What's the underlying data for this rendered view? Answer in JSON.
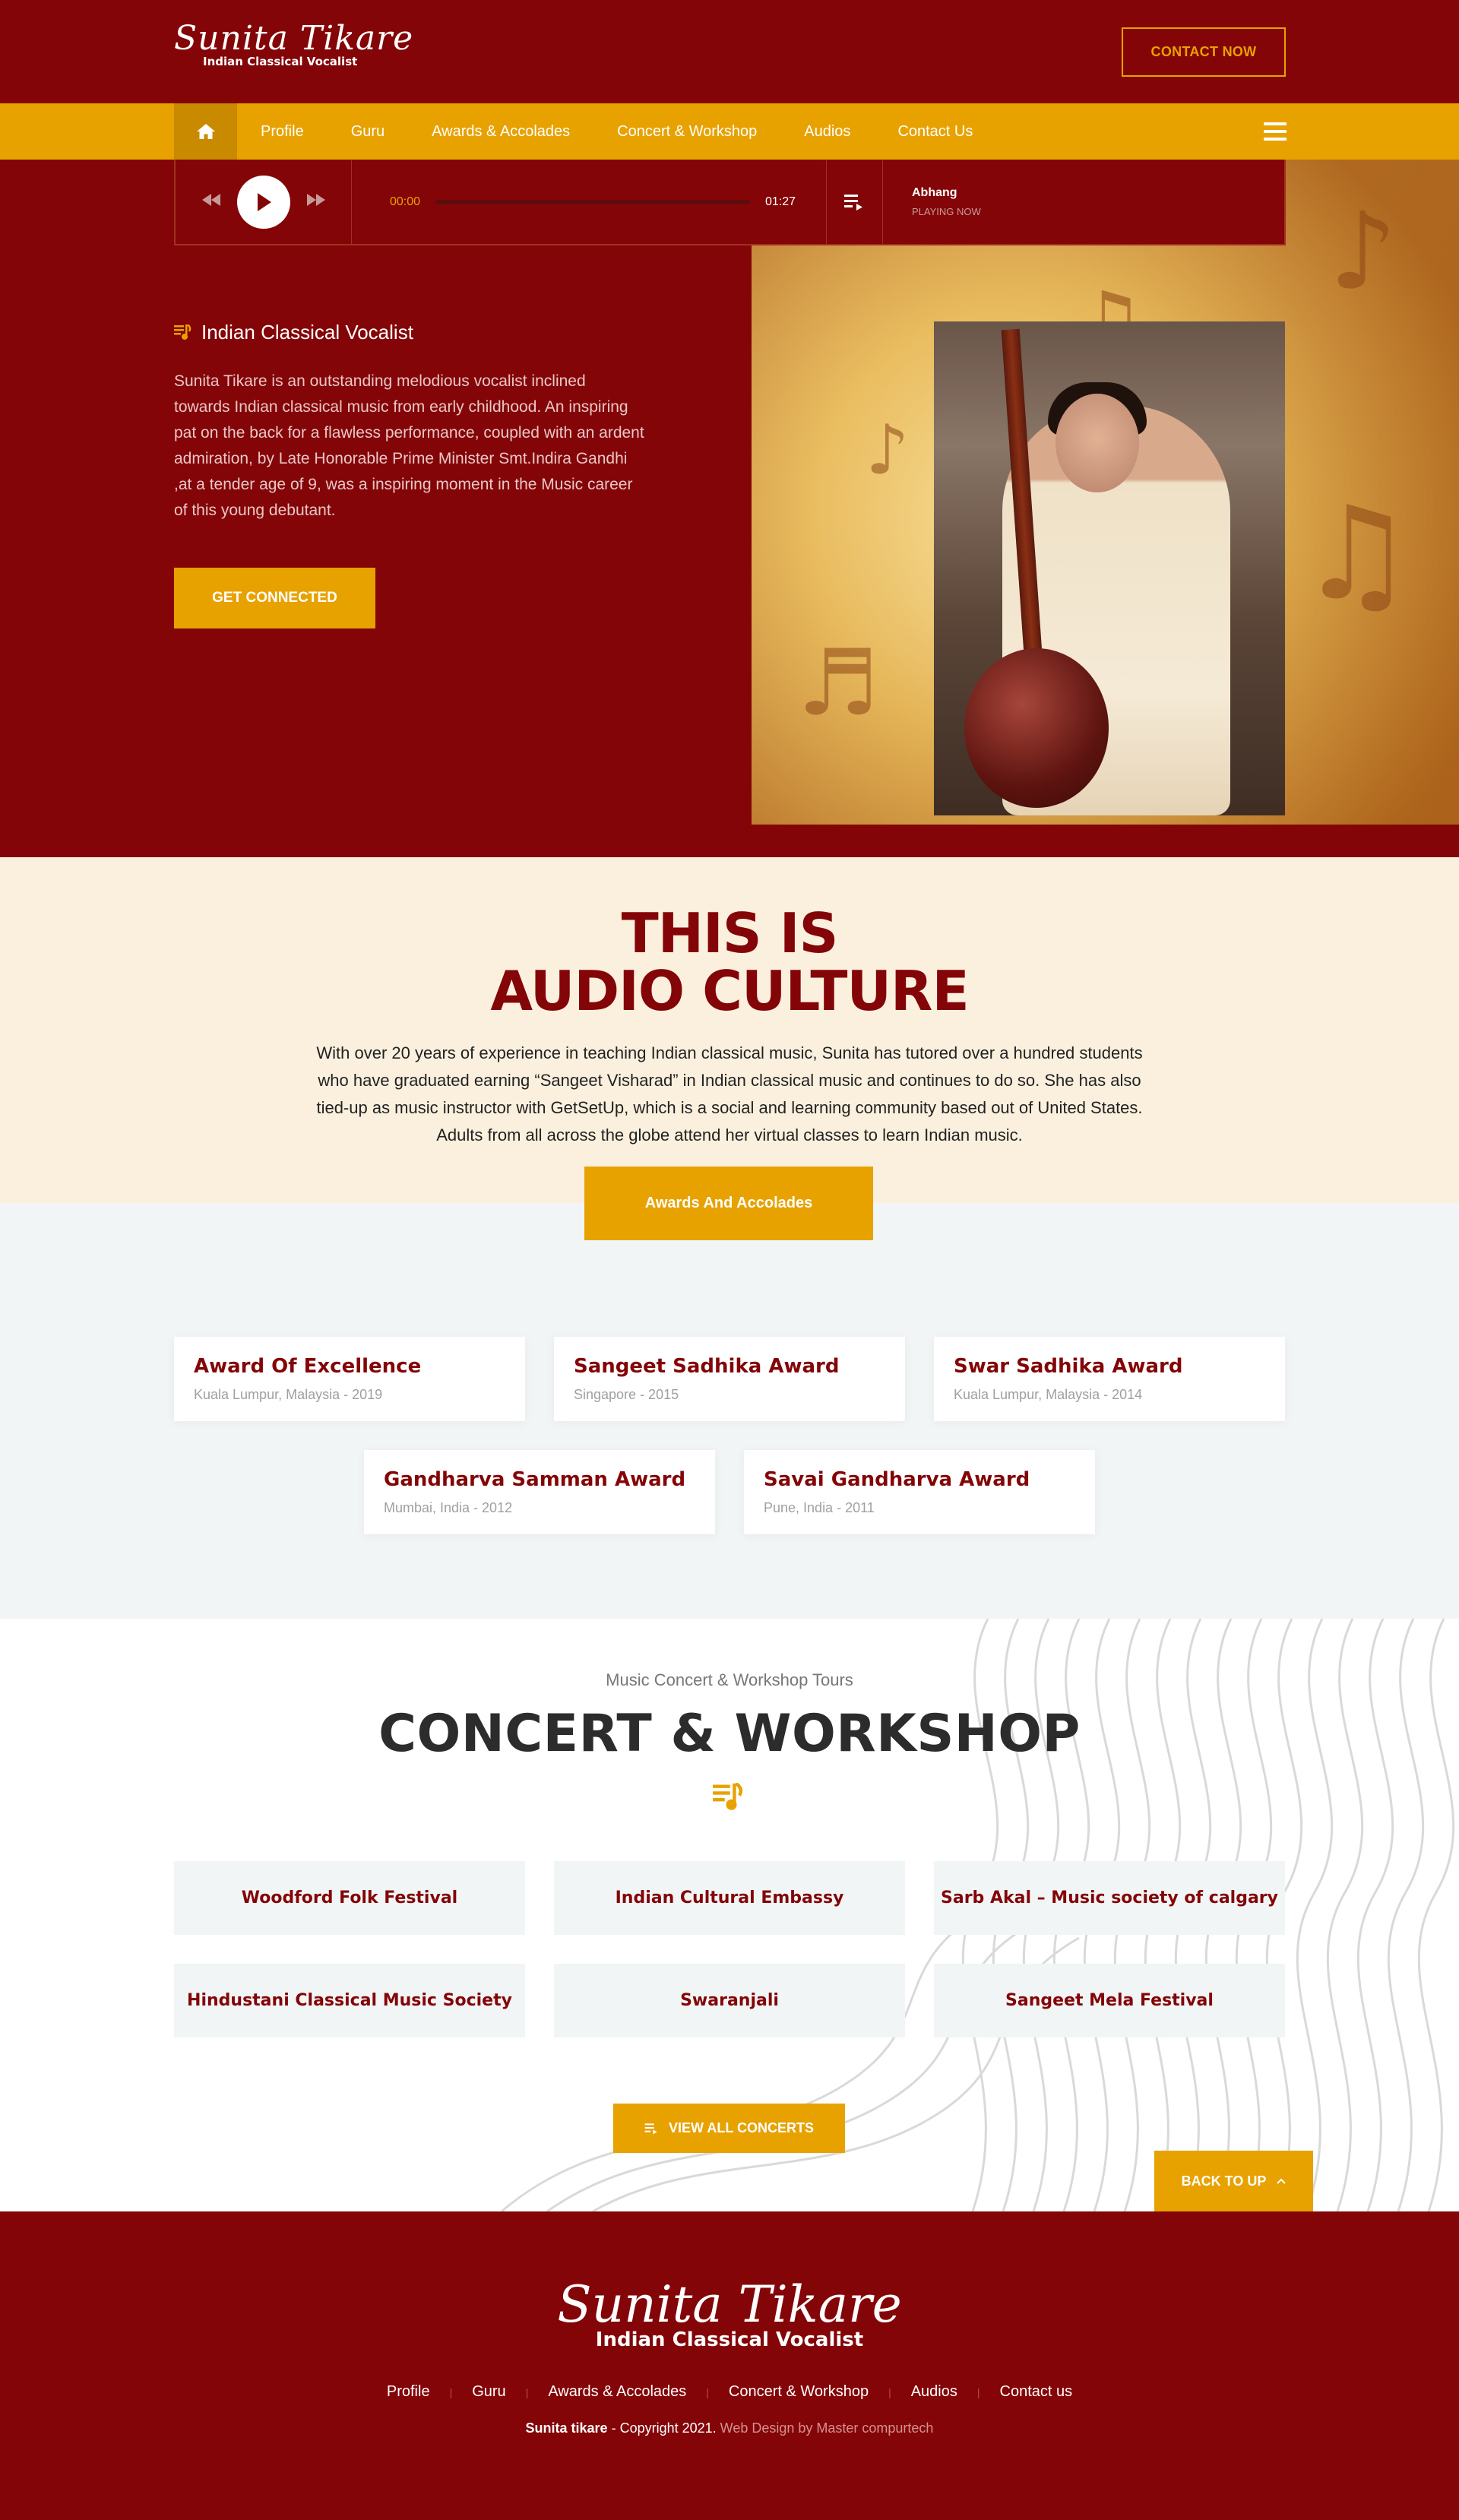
{
  "header": {
    "logo_script": "Sunita Tikare",
    "logo_sub": "Indian Classical Vocalist",
    "contact_button": "CONTACT NOW"
  },
  "nav": {
    "items": [
      "Profile",
      "Guru",
      "Awards & Accolades",
      "Concert & Workshop",
      "Audios",
      "Contact Us"
    ]
  },
  "player": {
    "current_time": "00:00",
    "duration": "01:27",
    "progress": 0,
    "track_title": "Abhang",
    "track_state": "PLAYING NOW"
  },
  "hero": {
    "tag": "Indian Classical Vocalist",
    "description": "Sunita Tikare is an outstanding melodious vocalist inclined towards Indian classical music from early childhood. An inspiring pat on the back for a flawless performance, coupled with an ardent admiration, by Late Honorable Prime Minister Smt.Indira Gandhi ,at a tender age of 9, was a inspiring moment in the Music career of this young debutant.",
    "cta": "GET CONNECTED"
  },
  "culture": {
    "heading_line1": "THIS IS",
    "heading_line2": "AUDIO CULTURE",
    "text": "With over 20 years of experience in teaching Indian classical music, Sunita has tutored over a hundred students who have graduated earning “Sangeet Visharad” in Indian classical music and continues to do so. She has also tied-up as music instructor with GetSetUp, which is a social and learning community based out of United States. Adults from all across the globe attend her virtual classes to learn Indian music.",
    "button": "Awards And Accolades"
  },
  "awards": [
    {
      "title": "Award Of Excellence",
      "detail": "Kuala Lumpur, Malaysia - 2019"
    },
    {
      "title": "Sangeet Sadhika Award",
      "detail": "Singapore - 2015"
    },
    {
      "title": "Swar Sadhika Award",
      "detail": "Kuala Lumpur, Malaysia - 2014"
    },
    {
      "title": "Gandharva Samman Award",
      "detail": "Mumbai, India - 2012"
    },
    {
      "title": "Savai Gandharva Award",
      "detail": "Pune, India - 2011"
    }
  ],
  "concerts": {
    "subtitle": "Music Concert & Workshop Tours",
    "heading": "CONCERT & WORKSHOP",
    "venues": [
      "Woodford Folk Festival",
      "Indian Cultural Embassy",
      "Sarb Akal – Music society of calgary",
      "Hindustani Classical Music Society",
      "Swaranjali",
      "Sangeet Mela Festival"
    ],
    "view_all": "VIEW ALL CONCERTS",
    "back_to_top": "BACK TO UP"
  },
  "footer": {
    "logo_script": "Sunita Tikare",
    "logo_sub": "Indian Classical Vocalist",
    "links": [
      "Profile",
      "Guru",
      "Awards & Accolades",
      "Concert & Workshop",
      "Audios",
      "Contact us"
    ],
    "copyright_name": "Sunita tikare",
    "copyright_text": " - Copyright 2021. ",
    "credit": "Web Design by Master compurtech"
  },
  "colors": {
    "maroon": "#840507",
    "gold": "#e7a200",
    "cream": "#faf0dd",
    "light_grey": "#f2f5f6"
  },
  "icons": [
    "home-icon",
    "hamburger-icon",
    "rewind-icon",
    "play-icon",
    "forward-icon",
    "playlist-icon",
    "music-note-icon",
    "chevron-up-icon"
  ]
}
